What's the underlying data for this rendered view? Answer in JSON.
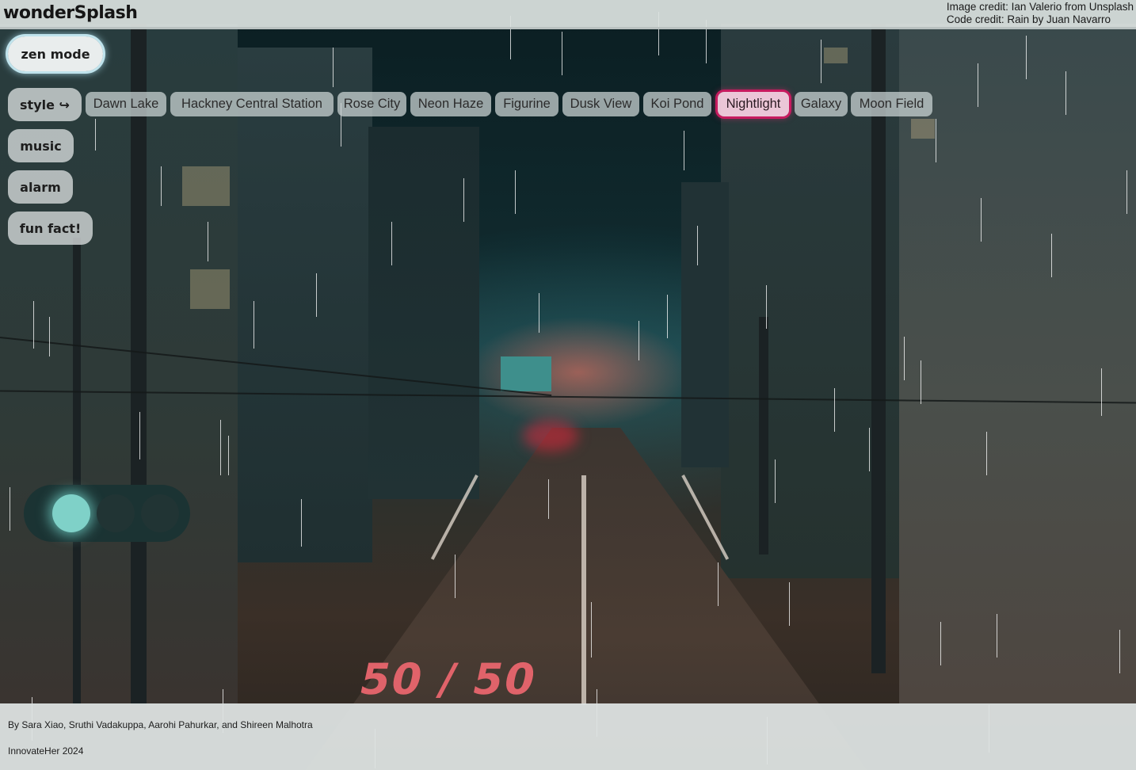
{
  "app": {
    "title": "wonderSplash"
  },
  "credits": {
    "image": "Image credit: Ian Valerio from Unsplash",
    "code": "Code credit: Rain by Juan Navarro"
  },
  "controls": {
    "zen_mode": "zen mode",
    "style": "style ↪",
    "music": "music",
    "alarm": "alarm",
    "fun_fact": "fun fact!"
  },
  "styles": {
    "options": [
      "Dawn Lake",
      "Hackney Central Station",
      "Rose City",
      "Neon Haze",
      "Figurine",
      "Dusk View",
      "Koi Pond",
      "Nightlight",
      "Galaxy",
      "Moon Field"
    ],
    "selected": "Nightlight"
  },
  "background": {
    "road_marking": "50 / 50"
  },
  "footer": {
    "authors": "By Sara Xiao, Sruthi Vadakuppa, Aarohi Pahurkar, and Shireen Malhotra",
    "event": "InnovateHer 2024"
  },
  "colors": {
    "selected_style_border": "#c71b5f",
    "zen_glow": "#bfe3ec",
    "bar_background": "#dde2e1"
  }
}
